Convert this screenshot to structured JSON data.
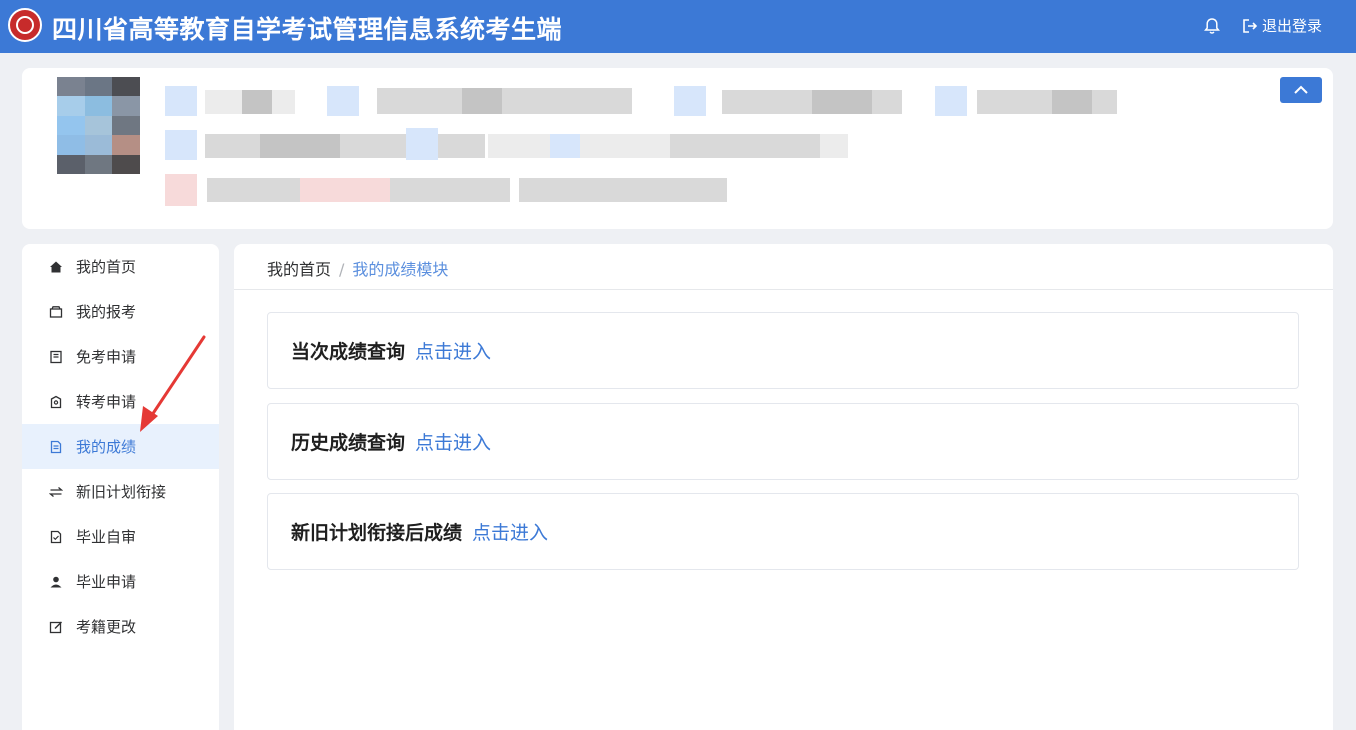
{
  "header": {
    "title": "四川省高等教育自学考试管理信息系统考生端",
    "logout_label": "退出登录",
    "bell_icon": "bell-icon",
    "logout_icon": "logout-icon",
    "background_color": "#3c79d6"
  },
  "profile": {
    "collapse_icon": "chevron-up-icon"
  },
  "sidebar": {
    "items": [
      {
        "label": "我的首页",
        "icon": "home-icon"
      },
      {
        "label": "我的报考",
        "icon": "box-icon"
      },
      {
        "label": "免考申请",
        "icon": "document-icon"
      },
      {
        "label": "转考申请",
        "icon": "transfer-doc-icon"
      },
      {
        "label": "我的成绩",
        "icon": "report-icon",
        "active": true
      },
      {
        "label": "新旧计划衔接",
        "icon": "swap-icon"
      },
      {
        "label": "毕业自审",
        "icon": "file-check-icon"
      },
      {
        "label": "毕业申请",
        "icon": "user-icon"
      },
      {
        "label": "考籍更改",
        "icon": "edit-icon"
      }
    ],
    "active_color": "#3c79d6"
  },
  "breadcrumb": {
    "home": "我的首页",
    "separator": "/",
    "current": "我的成绩模块"
  },
  "cards": [
    {
      "title": "当次成绩查询",
      "link": "点击进入"
    },
    {
      "title": "历史成绩查询",
      "link": "点击进入"
    },
    {
      "title": "新旧计划衔接后成绩",
      "link": "点击进入"
    }
  ],
  "annotation": {
    "arrow_color": "#e53935"
  }
}
